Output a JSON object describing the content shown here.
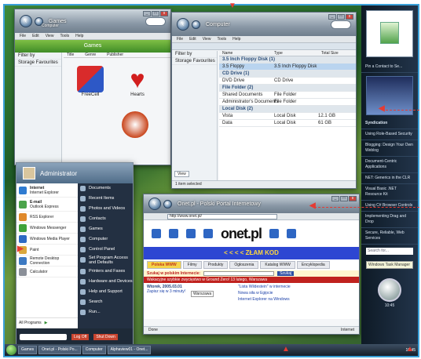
{
  "left_window": {
    "title": "Games",
    "crumb": "Computer",
    "group": "Games",
    "cols": [
      "Title",
      "Genre",
      "Publisher"
    ],
    "sidebar_items": [
      "Filter by",
      "Storage Favourites"
    ],
    "games": [
      "FreeCell",
      "Hearts"
    ]
  },
  "computer_window": {
    "title": "Computer",
    "menus": [
      "File",
      "Edit",
      "View",
      "Tools",
      "Help"
    ],
    "cols": [
      "Name",
      "Type",
      "Total Size"
    ],
    "sidebar_items": [
      "Filter by",
      "Storage Favourites"
    ],
    "groups": [
      {
        "label": "3.5 Inch Floppy Disk (1)",
        "rows": [
          [
            "3.5 Floppy",
            "3.5 Inch Floppy Disk"
          ]
        ]
      },
      {
        "label": "CD Drive (1)",
        "rows": [
          [
            "DVD Drive",
            "CD Drive"
          ]
        ]
      },
      {
        "label": "File Folder (2)",
        "rows": [
          [
            "Shared Documents",
            "File Folder"
          ],
          [
            "Administrator's Documents",
            "File Folder"
          ]
        ]
      },
      {
        "label": "Local Disk (2)",
        "rows": [
          [
            "Vista",
            "Local Disk",
            "12.1 GB"
          ],
          [
            "Data",
            "Local Disk",
            "61 GB"
          ]
        ]
      }
    ],
    "status": "1 item selected",
    "view_label": "View"
  },
  "games_menu": [
    "File",
    "Edit",
    "View",
    "Tools",
    "Help"
  ],
  "start_menu": {
    "user": "Administrator",
    "left_items": [
      {
        "label": "Internet",
        "sub": "Internet Explorer",
        "color": "#2e7bd1"
      },
      {
        "label": "E-mail",
        "sub": "Outlook Express",
        "color": "#4aa34a"
      },
      {
        "label": "RSS Explorer",
        "sub": "",
        "color": "#e0892a"
      },
      {
        "label": "Windows Messenger",
        "sub": "",
        "color": "#3fa33a"
      },
      {
        "label": "Windows Media Player",
        "sub": "",
        "color": "#2d6ac4"
      },
      {
        "label": "Paint",
        "sub": "",
        "color": "#d9a73c"
      },
      {
        "label": "Remote Desktop Connection",
        "sub": "",
        "color": "#3c79c2"
      },
      {
        "label": "Calculator",
        "sub": "",
        "color": "#8a8f98"
      }
    ],
    "right_items": [
      "Documents",
      "Recent Items",
      "Photos and Videos",
      "Contacts",
      "Games",
      "Computer",
      "Control Panel",
      "Set Program Access and Defaults",
      "Printers and Faxes",
      "Hardware and Devices",
      "Help and Support",
      "Search",
      "Run..."
    ],
    "all_programs": "All Programs",
    "logoff": "Log Off",
    "shutdown": "Shut Down"
  },
  "browser": {
    "title": "Onet.pl - Polski Portal Internetowy",
    "url": "http://www.onet.pl/",
    "logo": "onet.pl",
    "banner": "< < < <  ZŁAM KOD",
    "tabs": [
      "Polska WWW",
      "Filmy",
      "Produkty",
      "Ogłoszenia",
      "Katalog WWW",
      "Encyklopedia"
    ],
    "search_label": "Szukaj w polskim Internecie:",
    "search_button": "Szukaj",
    "ticker": "Wakacyjne szybkie zwycięstwo w Ground Zero! 13 lutego, Warszawa",
    "date_line": "Wtorek, 2005.03.01",
    "news": [
      "Zapisz się w 3 minuty!",
      "\"Lista Wildestein\" w internecie",
      "Nowa siła w Egipcie",
      "Internet Explorer na Windows"
    ],
    "weather_label": "Warszawa",
    "status": "Done",
    "zone": "Internet"
  },
  "sidebar": {
    "gadget_caption": "Pin a Contact to Se...",
    "feed_title": "Syndication",
    "feeds": [
      "Using Role-Based Security",
      "Blogging: Design Your Own Weblog",
      "Document-Centric Applications",
      "NET: Generics in the CLR",
      "Visual Basic .NET Resource Kit",
      "Using C# Browser Controls",
      "Implementing Drag and Drop",
      "Secure, Reliable, Web Services"
    ],
    "search": "Search for...",
    "clock": "10:45",
    "tooltip": "Windows Task Manager"
  },
  "taskbar": {
    "buttons": [
      "Games",
      "Onet.pl - Polski Po...",
      "Computer",
      "Alphaview01 - Onet..."
    ],
    "tray": "10:45"
  }
}
